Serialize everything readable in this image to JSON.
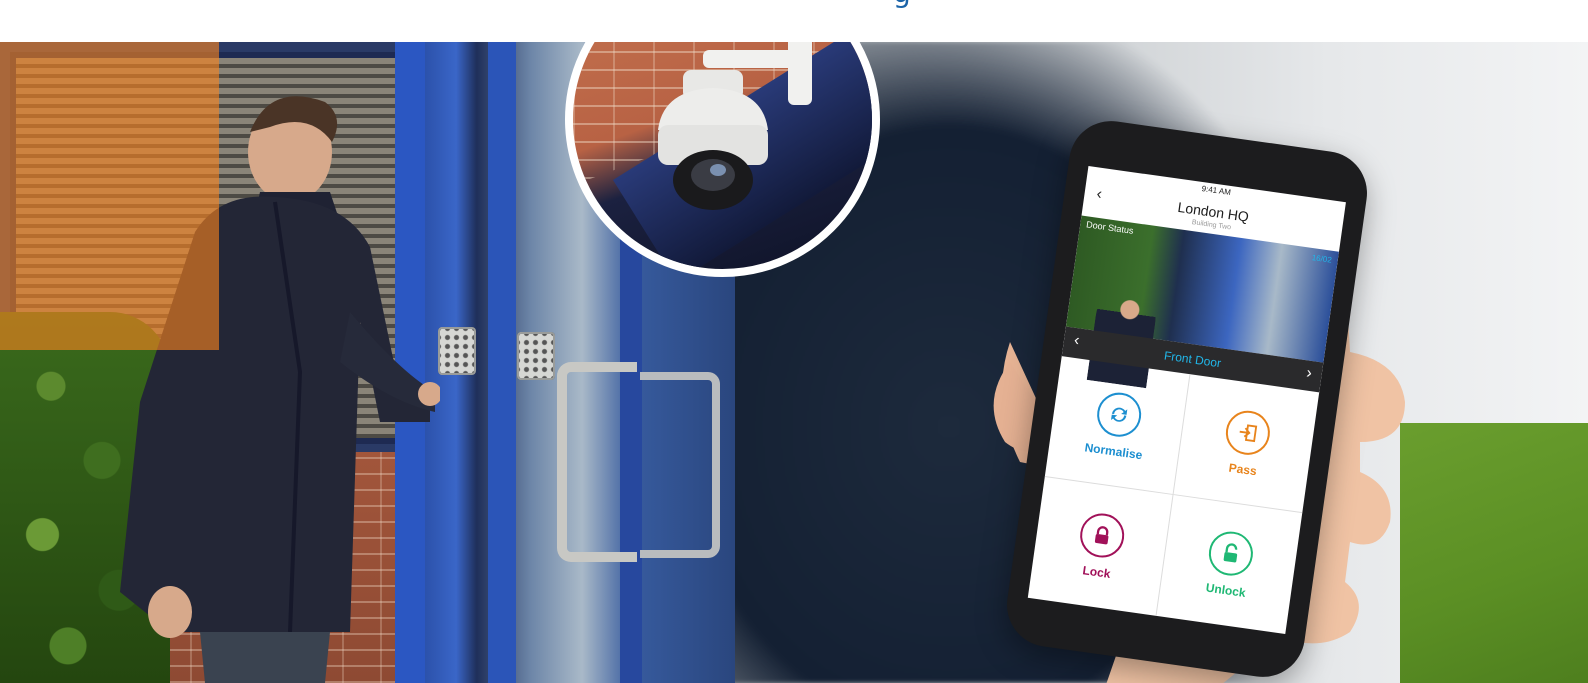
{
  "colors": {
    "orange_block": "#f7821e",
    "green_block": "#5b8f24",
    "accent_blue": "#21b6e8",
    "normalise": "#1d8fd0",
    "pass": "#e8841c",
    "lock": "#a11159",
    "unlock": "#1fb874"
  },
  "app": {
    "status_time": "9:41 AM",
    "title": "London HQ",
    "subtitle": "Building Two",
    "door_status_label": "Door Status",
    "feed_date": "16/02",
    "door_name": "Front Door",
    "actions": [
      {
        "label": "Normalise",
        "icon": "refresh-icon"
      },
      {
        "label": "Pass",
        "icon": "enter-icon"
      },
      {
        "label": "Lock",
        "icon": "lock-icon"
      },
      {
        "label": "Unlock",
        "icon": "unlock-icon"
      }
    ]
  }
}
